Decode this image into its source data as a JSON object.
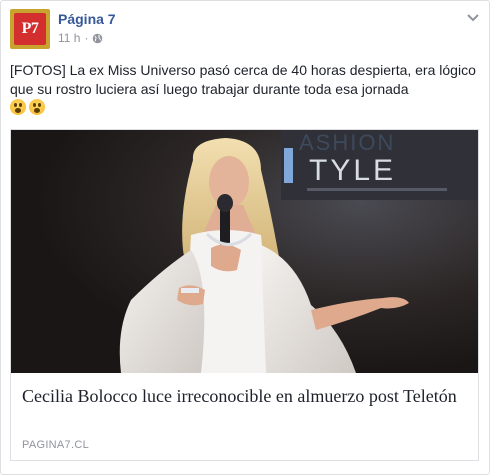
{
  "post": {
    "page_name": "Página 7",
    "avatar_text": "P7",
    "time": "11 h",
    "separator": "·",
    "text": "[FOTOS] La ex Miss Universo pasó cerca de 40 horas despierta, era lógico que su rostro luciera así luego trabajar durante toda esa jornada",
    "emojis": [
      "wow-emoji",
      "wow-emoji"
    ]
  },
  "link": {
    "title": "Cecilia Bolocco luce irreconocible en almuerzo post Teletón",
    "domain": "PAGINA7.CL",
    "image_backdrop_text": "ASHION\nTYLE"
  },
  "colors": {
    "link_blue": "#365899",
    "meta_gray": "#90949c",
    "avatar_red": "#d32f2f",
    "avatar_gold": "#c8a42e"
  }
}
